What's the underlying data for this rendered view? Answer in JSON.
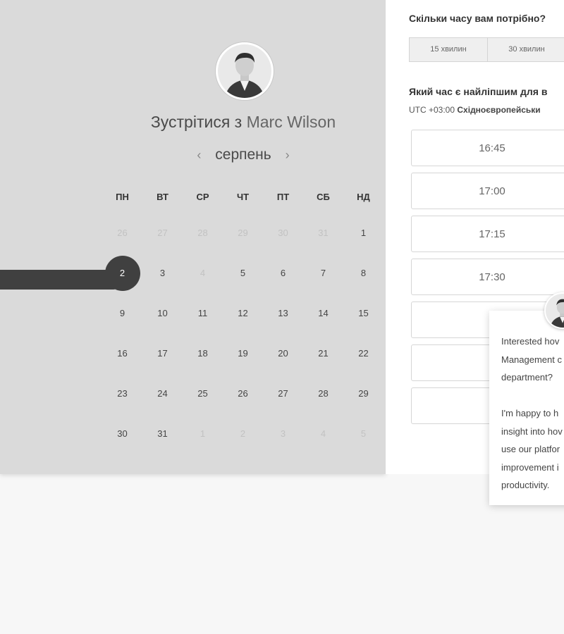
{
  "calendar": {
    "title_prefix": "Зустрітися з",
    "host_name": "Marc Wilson",
    "month": "серпень",
    "prev_icon": "‹",
    "next_icon": "›",
    "weekdays": [
      "ПН",
      "ВТ",
      "СР",
      "ЧТ",
      "ПТ",
      "СБ",
      "НД"
    ],
    "weeks": [
      [
        "26",
        "27",
        "28",
        "29",
        "30",
        "31",
        "1"
      ],
      [
        "2",
        "3",
        "4",
        "5",
        "6",
        "7",
        "8"
      ],
      [
        "9",
        "10",
        "11",
        "12",
        "13",
        "14",
        "15"
      ],
      [
        "16",
        "17",
        "18",
        "19",
        "20",
        "21",
        "22"
      ],
      [
        "23",
        "24",
        "25",
        "26",
        "27",
        "28",
        "29"
      ],
      [
        "30",
        "31",
        "1",
        "2",
        "3",
        "4",
        "5"
      ]
    ],
    "selected_day": "2"
  },
  "booking": {
    "duration_question": "Скільки часу вам потрібно?",
    "durations": [
      "15 хвилин",
      "30 хвилин"
    ],
    "time_question": "Який час є найліпшим для в",
    "timezone_offset": "UTC +03:00",
    "timezone_name": "Східноєвропейськи",
    "slots": [
      "16:45",
      "17:00",
      "17:15",
      "17:30",
      "",
      "",
      ""
    ]
  },
  "chat_popup": {
    "para1": [
      "Interested hov",
      "Management c",
      "department?"
    ],
    "para2": [
      "I'm happy to h",
      "insight into hov",
      "use our platfor",
      "improvement i",
      "productivity."
    ]
  },
  "colors": {
    "selected": "#404040",
    "panel": "#dadada"
  }
}
